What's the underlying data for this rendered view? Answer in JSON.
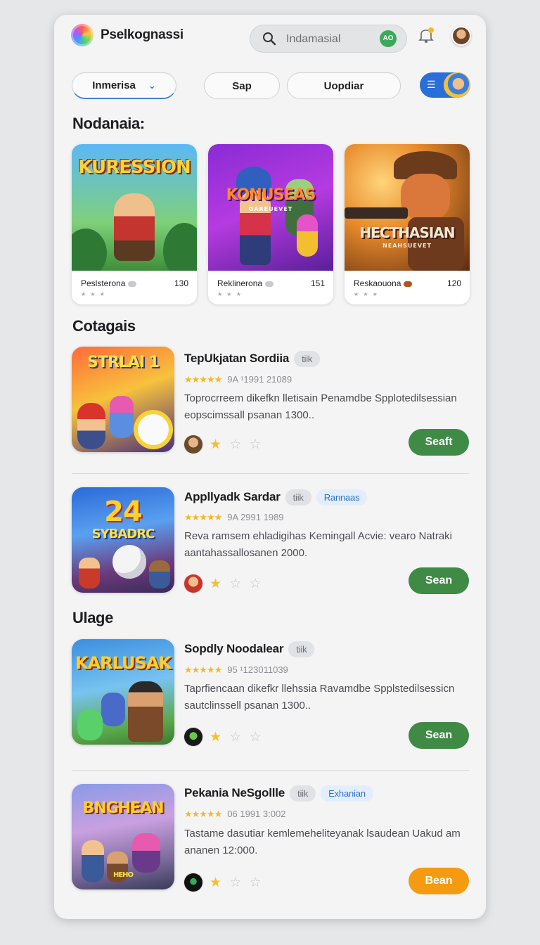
{
  "header": {
    "app_title": "Pselkognassi",
    "search_placeholder": "Indamasial",
    "mic_badge": "AO",
    "icons": {
      "logo": "app-logo",
      "search": "search-icon",
      "mic": "mic-icon",
      "bell": "bell-icon",
      "avatar": "user-avatar"
    }
  },
  "filters": {
    "dropdown": "Inmerisa",
    "chip_2": "Sap",
    "chip_3": "Uopdiar",
    "view_toggle_icon": "list-view-icon"
  },
  "featured": {
    "title": "Nodanaia:",
    "cards": [
      {
        "art_text": "KURESSION",
        "art_sub": "",
        "name": "Peslsterona",
        "count": "130",
        "stars": "★ ★ ★",
        "dot_color": "#c9cacf"
      },
      {
        "art_text": "KONUSEAS",
        "art_sub": "GAREUEVET",
        "name": "Reklinerona",
        "count": "151",
        "stars": "★ ★ ★",
        "dot_color": "#c9cacf"
      },
      {
        "art_text": "HECTHASIAN",
        "art_sub": "NEAHSUEVET",
        "name": "Reskaouona",
        "count": "120",
        "stars": "★ ★ ★",
        "dot_color": "#b5531c"
      }
    ]
  },
  "section_categories": "Cotagais",
  "section_village": "Ulage",
  "list": [
    {
      "art_text": "STRLAI 1",
      "title": "TepUkjatan Sordiia",
      "chip1": "tiik",
      "chip2": "",
      "rating": "★★★★★",
      "meta": "9A ¹1991 21089",
      "desc": "Toprocrreem dikefkn lletisain Penamdbe Spplotedilsessian eopscimssall psanan 1300..",
      "stars_filled": "★",
      "stars_empty": "☆ ☆",
      "action": "Seaft"
    },
    {
      "art_text": "24",
      "art_sub": "SYBADRC",
      "title": "Appllyadk Sardar",
      "chip1": "tiik",
      "chip2": "Rannaas",
      "rating": "★★★★★",
      "meta": "9A 2991 1989",
      "desc": "Reva ramsem ehladigihas Kemingall Acvie: vearo Natraki aantahassallosanen 2000.",
      "stars_filled": "★",
      "stars_empty": "☆ ☆",
      "action": "Sean"
    },
    {
      "art_text": "KARLUSAK",
      "title": "Sopdly Noodalear",
      "chip1": "tiik",
      "chip2": "",
      "rating": "★★★★★",
      "meta": "95 ¹123011039",
      "desc": "Taprfiencaan dikefkr llehssia Ravamdbe Spplstedilsessicn sautclinssell psanan 1300..",
      "stars_filled": "★",
      "stars_empty": "☆ ☆",
      "action": "Sean"
    },
    {
      "art_text": "BNGHEAN",
      "art_sub": "HEHO",
      "title": "Pekania NeSgollle",
      "chip1": "tiik",
      "chip2": "Exhanian",
      "rating": "★★★★★",
      "meta": "06 1991 3:002",
      "desc": "Tastame dasutiar kemlemeheliteyanak lsaudean Uakud am ananen 12:000.",
      "stars_filled": "★",
      "stars_empty": "☆ ☆",
      "action": "Bean"
    }
  ],
  "colors": {
    "accent_blue": "#2a6ed8",
    "action_green": "#3f8a45",
    "action_orange": "#f59b12",
    "star_gold": "#f4b925"
  }
}
